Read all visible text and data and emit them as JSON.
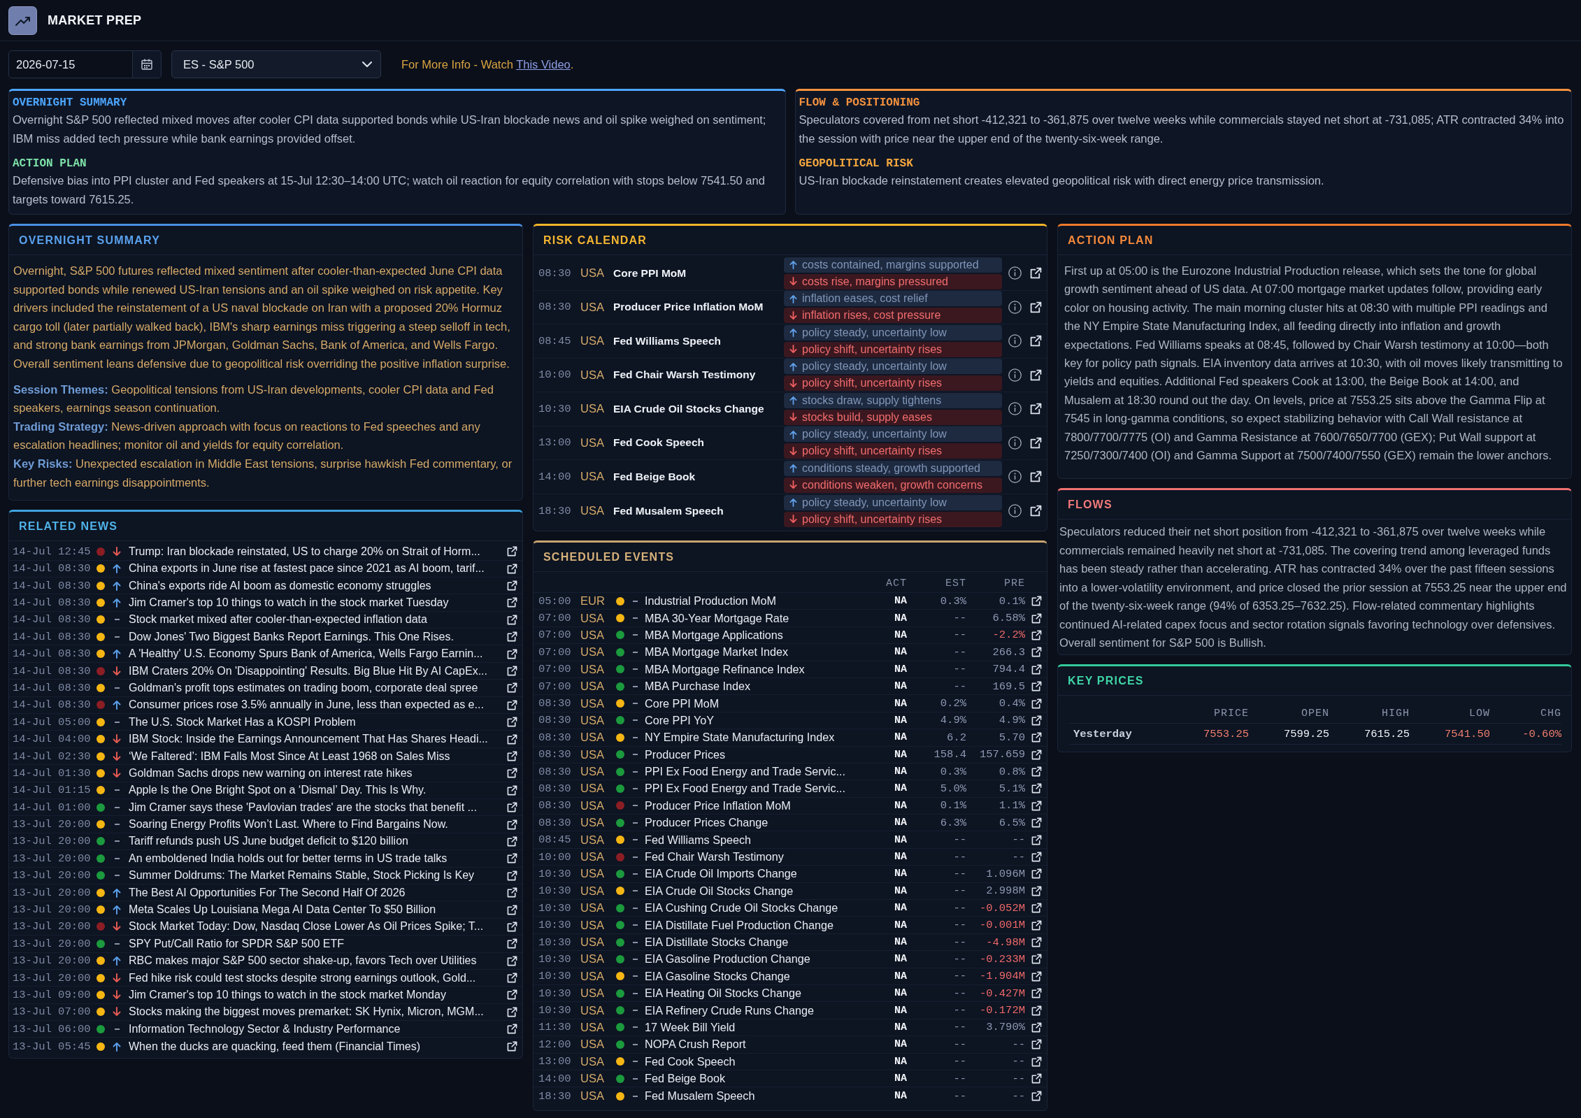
{
  "app": {
    "title": "MARKET PREP"
  },
  "controls": {
    "date": "2026-07-15",
    "instrument": "ES - S&P 500",
    "info": {
      "text": "For More Info - Watch",
      "link": "This Video",
      "end": "."
    }
  },
  "briefing": [
    {
      "sections": [
        {
          "heading": "OVERNIGHT SUMMARY",
          "color": "#4da6ff",
          "text": "Overnight S&P 500 reflected mixed moves after cooler CPI data supported bonds while US-Iran blockade news and oil spike weighed on sentiment; IBM miss added tech pressure while bank earnings provided offset."
        },
        {
          "heading": "ACTION PLAN",
          "color": "#7ee2a8",
          "text": "Defensive bias into PPI cluster and Fed speakers at 15-Jul 12:30–14:00 UTC; watch oil reaction for equity correlation with stops below 7541.50 and targets toward 7615.25."
        }
      ]
    },
    {
      "sections": [
        {
          "heading": "FLOW & POSITIONING",
          "color": "#f5923e",
          "text": "Speculators covered from net short -412,321 to -361,875 over twelve weeks while commercials stayed net short at -731,085; ATR contracted 34% into the session with price near the upper end of the twenty-six-week range."
        },
        {
          "heading": "GEOPOLITICAL RISK",
          "color": "#f7a83e",
          "text": "US-Iran blockade reinstatement creates elevated geopolitical risk with direct energy price transmission."
        }
      ]
    }
  ],
  "overnight": {
    "title": "OVERNIGHT SUMMARY",
    "text": "Overnight, S&P 500 futures reflected mixed sentiment after cooler-than-expected June CPI data supported bonds while renewed US-Iran tensions and an oil spike weighed on risk appetite. Key drivers included the reinstatement of a US naval blockade on Iran with a proposed 20% Hormuz cargo toll (later partially walked back), IBM's sharp earnings miss triggering a steep selloff in tech, and strong bank earnings from JPMorgan, Goldman Sachs, Bank of America, and Wells Fargo. Overall sentiment leans defensive due to geopolitical risk overriding the positive inflation surprise.",
    "details": [
      "**Session Themes:** Geopolitical tensions from US-Iran developments, cooler CPI data and Fed speakers, earnings season continuation.",
      "**Trading Strategy:** News-driven approach with focus on reactions to Fed speeches and any escalation headlines; monitor oil and yields for equity correlation.",
      "**Key Risks:** Unexpected escalation in Middle East tensions, surprise hawkish Fed commentary, or further tech earnings disappointments."
    ]
  },
  "news": {
    "title": "RELATED NEWS",
    "items": [
      {
        "time": "14-Jul 12:45",
        "color": "#8b1e24",
        "rising": false,
        "falling": true,
        "headline": "Trump: Iran blockade reinstated, US to charge 20% on Strait of Horm..."
      },
      {
        "time": "14-Jul 08:30",
        "color": "#f5b614",
        "rising": true,
        "falling": false,
        "headline": "China exports in June rise at fastest pace since 2021 as AI boom, tarif..."
      },
      {
        "time": "14-Jul 08:30",
        "color": "#f5b614",
        "rising": true,
        "falling": false,
        "headline": "China's exports ride AI boom as domestic economy struggles"
      },
      {
        "time": "14-Jul 08:30",
        "color": "#f5b614",
        "rising": true,
        "falling": false,
        "headline": "Jim Cramer's top 10 things to watch in the stock market Tuesday"
      },
      {
        "time": "14-Jul 08:30",
        "color": "#f5b614",
        "rising": false,
        "falling": false,
        "headline": "Stock market mixed after cooler-than-expected inflation data"
      },
      {
        "time": "14-Jul 08:30",
        "color": "#f5b614",
        "rising": false,
        "falling": false,
        "headline": "Dow Jones' Two Biggest Banks Report Earnings. This One Rises."
      },
      {
        "time": "14-Jul 08:30",
        "color": "#f5b614",
        "rising": true,
        "falling": false,
        "headline": "A 'Healthy' U.S. Economy Spurs Bank of America, Wells Fargo Earnin..."
      },
      {
        "time": "14-Jul 08:30",
        "color": "#8b1e24",
        "rising": false,
        "falling": true,
        "headline": "IBM Craters 20% On 'Disappointing' Results. Big Blue Hit By AI CapEx..."
      },
      {
        "time": "14-Jul 08:30",
        "color": "#f5b614",
        "rising": false,
        "falling": false,
        "headline": "Goldman's profit tops estimates on trading boom, corporate deal spree"
      },
      {
        "time": "14-Jul 08:30",
        "color": "#8b1e24",
        "rising": true,
        "falling": false,
        "headline": "Consumer prices rose 3.5% annually in June, less than expected as e..."
      },
      {
        "time": "14-Jul 05:00",
        "color": "#f5b614",
        "rising": false,
        "falling": false,
        "headline": "The U.S. Stock Market Has a KOSPI Problem"
      },
      {
        "time": "14-Jul 04:00",
        "color": "#f5b614",
        "rising": false,
        "falling": true,
        "headline": "IBM Stock: Inside the Earnings Announcement That Has Shares Headi..."
      },
      {
        "time": "14-Jul 02:30",
        "color": "#f5b614",
        "rising": false,
        "falling": true,
        "headline": "‘We Faltered’: IBM Falls Most Since At Least 1968 on Sales Miss"
      },
      {
        "time": "14-Jul 01:30",
        "color": "#f5b614",
        "rising": false,
        "falling": true,
        "headline": "Goldman Sachs drops new warning on interest rate hikes"
      },
      {
        "time": "14-Jul 01:15",
        "color": "#f5b614",
        "rising": false,
        "falling": false,
        "headline": "Apple Is the One Bright Spot on a ‘Dismal’ Day. This Is Why."
      },
      {
        "time": "14-Jul 01:00",
        "color": "#1c9a3e",
        "rising": false,
        "falling": false,
        "headline": "Jim Cramer says these 'Pavlovian trades' are the stocks that benefit ..."
      },
      {
        "time": "13-Jul 20:00",
        "color": "#f5b614",
        "rising": false,
        "falling": false,
        "headline": "Soaring Energy Profits Won’t Last. Where to Find Bargains Now."
      },
      {
        "time": "13-Jul 20:00",
        "color": "#1c9a3e",
        "rising": false,
        "falling": false,
        "headline": "Tariff refunds push US June budget deficit to $120 billion"
      },
      {
        "time": "13-Jul 20:00",
        "color": "#1c9a3e",
        "rising": false,
        "falling": false,
        "headline": "An emboldened India holds out for better terms in US trade talks"
      },
      {
        "time": "13-Jul 20:00",
        "color": "#1c9a3e",
        "rising": false,
        "falling": false,
        "headline": "Summer Doldrums: The Market Remains Stable, Stock Picking Is Key"
      },
      {
        "time": "13-Jul 20:00",
        "color": "#f5b614",
        "rising": true,
        "falling": false,
        "headline": "The Best AI Opportunities For The Second Half Of 2026"
      },
      {
        "time": "13-Jul 20:00",
        "color": "#f5b614",
        "rising": true,
        "falling": false,
        "headline": "Meta Scales Up Louisiana Mega AI Data Center To $50 Billion"
      },
      {
        "time": "13-Jul 20:00",
        "color": "#8b1e24",
        "rising": false,
        "falling": true,
        "headline": "Stock Market Today: Dow, Nasdaq Close Lower As Oil Prices Spike; T..."
      },
      {
        "time": "13-Jul 20:00",
        "color": "#1c9a3e",
        "rising": false,
        "falling": false,
        "headline": "SPY Put/Call Ratio for SPDR S&P 500 ETF"
      },
      {
        "time": "13-Jul 20:00",
        "color": "#f5b614",
        "rising": true,
        "falling": false,
        "headline": "RBC makes major S&P 500 sector shake-up, favors Tech over Utilities"
      },
      {
        "time": "13-Jul 20:00",
        "color": "#f5b614",
        "rising": false,
        "falling": true,
        "headline": "Fed hike risk could test stocks despite strong earnings outlook, Gold..."
      },
      {
        "time": "13-Jul 09:00",
        "color": "#f5b614",
        "rising": false,
        "falling": true,
        "headline": "Jim Cramer's top 10 things to watch in the stock market Monday"
      },
      {
        "time": "13-Jul 07:00",
        "color": "#f5b614",
        "rising": false,
        "falling": true,
        "headline": "Stocks making the biggest moves premarket: SK Hynix, Micron, MGM..."
      },
      {
        "time": "13-Jul 06:00",
        "color": "#1c9a3e",
        "rising": false,
        "falling": false,
        "headline": "Information Technology Sector & Industry Performance"
      },
      {
        "time": "13-Jul 05:45",
        "color": "#f5b614",
        "rising": true,
        "falling": false,
        "headline": "When the ducks are quacking, feed them (Financial Times)"
      }
    ]
  },
  "risk_calendar": {
    "title": "RISK CALENDAR",
    "rows": [
      {
        "time": "08:30",
        "region": "USA",
        "event": "Core PPI MoM",
        "upside": "costs contained, margins supported",
        "downside": "costs rise, margins pressured"
      },
      {
        "time": "08:30",
        "region": "USA",
        "event": "Producer Price Inflation MoM",
        "upside": "inflation eases, cost relief",
        "downside": "inflation rises, cost pressure"
      },
      {
        "time": "08:45",
        "region": "USA",
        "event": "Fed Williams Speech",
        "upside": "policy steady, uncertainty low",
        "downside": "policy shift, uncertainty rises"
      },
      {
        "time": "10:00",
        "region": "USA",
        "event": "Fed Chair Warsh Testimony",
        "upside": "policy steady, uncertainty low",
        "downside": "policy shift, uncertainty rises"
      },
      {
        "time": "10:30",
        "region": "USA",
        "event": "EIA Crude Oil Stocks Change",
        "upside": "stocks draw, supply tightens",
        "downside": "stocks build, supply eases"
      },
      {
        "time": "13:00",
        "region": "USA",
        "event": "Fed Cook Speech",
        "upside": "policy steady, uncertainty low",
        "downside": "policy shift, uncertainty rises"
      },
      {
        "time": "14:00",
        "region": "USA",
        "event": "Fed Beige Book",
        "upside": "conditions steady, growth supported",
        "downside": "conditions weaken, growth concerns"
      },
      {
        "time": "18:30",
        "region": "USA",
        "event": "Fed Musalem Speech",
        "upside": "policy steady, uncertainty low",
        "downside": "policy shift, uncertainty rises"
      }
    ]
  },
  "events": {
    "title": "SCHEDULED EVENTS",
    "columns": [
      "ACT",
      "EST",
      "PRE"
    ],
    "rows": [
      {
        "time": "05:00",
        "region": "EUR",
        "color": "#f5b614",
        "rising": false,
        "falling": false,
        "name": "Industrial Production MoM",
        "act": "NA",
        "est": "0.3%",
        "pre": "0.1%",
        "pre_negative": false
      },
      {
        "time": "07:00",
        "region": "USA",
        "color": "#f5b614",
        "rising": false,
        "falling": false,
        "name": "MBA 30-Year Mortgage Rate",
        "act": "NA",
        "est": "--",
        "pre": "6.58%",
        "pre_negative": false
      },
      {
        "time": "07:00",
        "region": "USA",
        "color": "#1c9a3e",
        "rising": false,
        "falling": false,
        "name": "MBA Mortgage Applications",
        "act": "NA",
        "est": "--",
        "pre": "-2.2%",
        "pre_negative": true
      },
      {
        "time": "07:00",
        "region": "USA",
        "color": "#1c9a3e",
        "rising": false,
        "falling": false,
        "name": "MBA Mortgage Market Index",
        "act": "NA",
        "est": "--",
        "pre": "266.3",
        "pre_negative": false
      },
      {
        "time": "07:00",
        "region": "USA",
        "color": "#1c9a3e",
        "rising": false,
        "falling": false,
        "name": "MBA Mortgage Refinance Index",
        "act": "NA",
        "est": "--",
        "pre": "794.4",
        "pre_negative": false
      },
      {
        "time": "07:00",
        "region": "USA",
        "color": "#1c9a3e",
        "rising": false,
        "falling": false,
        "name": "MBA Purchase Index",
        "act": "NA",
        "est": "--",
        "pre": "169.5",
        "pre_negative": false
      },
      {
        "time": "08:30",
        "region": "USA",
        "color": "#f5b614",
        "rising": false,
        "falling": false,
        "name": "Core PPI MoM",
        "act": "NA",
        "est": "0.2%",
        "pre": "0.4%",
        "pre_negative": false
      },
      {
        "time": "08:30",
        "region": "USA",
        "color": "#1c9a3e",
        "rising": false,
        "falling": false,
        "name": "Core PPI YoY",
        "act": "NA",
        "est": "4.9%",
        "pre": "4.9%",
        "pre_negative": false
      },
      {
        "time": "08:30",
        "region": "USA",
        "color": "#f5b614",
        "rising": false,
        "falling": false,
        "name": "NY Empire State Manufacturing Index",
        "act": "NA",
        "est": "6.2",
        "pre": "5.70",
        "pre_negative": false
      },
      {
        "time": "08:30",
        "region": "USA",
        "color": "#1c9a3e",
        "rising": false,
        "falling": false,
        "name": "Producer Prices",
        "act": "NA",
        "est": "158.4",
        "pre": "157.659",
        "pre_negative": false
      },
      {
        "time": "08:30",
        "region": "USA",
        "color": "#1c9a3e",
        "rising": false,
        "falling": false,
        "name": "PPI Ex Food Energy and Trade Servic...",
        "act": "NA",
        "est": "0.3%",
        "pre": "0.8%",
        "pre_negative": false
      },
      {
        "time": "08:30",
        "region": "USA",
        "color": "#1c9a3e",
        "rising": false,
        "falling": false,
        "name": "PPI Ex Food Energy and Trade Servic...",
        "act": "NA",
        "est": "5.0%",
        "pre": "5.1%",
        "pre_negative": false
      },
      {
        "time": "08:30",
        "region": "USA",
        "color": "#8b1e24",
        "rising": false,
        "falling": false,
        "name": "Producer Price Inflation MoM",
        "act": "NA",
        "est": "0.1%",
        "pre": "1.1%",
        "pre_negative": false
      },
      {
        "time": "08:30",
        "region": "USA",
        "color": "#1c9a3e",
        "rising": false,
        "falling": false,
        "name": "Producer Prices Change",
        "act": "NA",
        "est": "6.3%",
        "pre": "6.5%",
        "pre_negative": false
      },
      {
        "time": "08:45",
        "region": "USA",
        "color": "#f5b614",
        "rising": false,
        "falling": false,
        "name": "Fed Williams Speech",
        "act": "NA",
        "est": "--",
        "pre": "--",
        "pre_negative": false
      },
      {
        "time": "10:00",
        "region": "USA",
        "color": "#8b1e24",
        "rising": false,
        "falling": false,
        "name": "Fed Chair Warsh Testimony",
        "act": "NA",
        "est": "--",
        "pre": "--",
        "pre_negative": false
      },
      {
        "time": "10:30",
        "region": "USA",
        "color": "#1c9a3e",
        "rising": false,
        "falling": false,
        "name": "EIA Crude Oil Imports Change",
        "act": "NA",
        "est": "--",
        "pre": "1.096M",
        "pre_negative": false
      },
      {
        "time": "10:30",
        "region": "USA",
        "color": "#f5b614",
        "rising": false,
        "falling": false,
        "name": "EIA Crude Oil Stocks Change",
        "act": "NA",
        "est": "--",
        "pre": "2.998M",
        "pre_negative": false
      },
      {
        "time": "10:30",
        "region": "USA",
        "color": "#1c9a3e",
        "rising": false,
        "falling": false,
        "name": "EIA Cushing Crude Oil Stocks Change",
        "act": "NA",
        "est": "--",
        "pre": "-0.052M",
        "pre_negative": true
      },
      {
        "time": "10:30",
        "region": "USA",
        "color": "#1c9a3e",
        "rising": false,
        "falling": false,
        "name": "EIA Distillate Fuel Production Change",
        "act": "NA",
        "est": "--",
        "pre": "-0.001M",
        "pre_negative": true
      },
      {
        "time": "10:30",
        "region": "USA",
        "color": "#1c9a3e",
        "rising": false,
        "falling": false,
        "name": "EIA Distillate Stocks Change",
        "act": "NA",
        "est": "--",
        "pre": "-4.98M",
        "pre_negative": true
      },
      {
        "time": "10:30",
        "region": "USA",
        "color": "#1c9a3e",
        "rising": false,
        "falling": false,
        "name": "EIA Gasoline Production Change",
        "act": "NA",
        "est": "--",
        "pre": "-0.233M",
        "pre_negative": true
      },
      {
        "time": "10:30",
        "region": "USA",
        "color": "#f5b614",
        "rising": false,
        "falling": false,
        "name": "EIA Gasoline Stocks Change",
        "act": "NA",
        "est": "--",
        "pre": "-1.904M",
        "pre_negative": true
      },
      {
        "time": "10:30",
        "region": "USA",
        "color": "#1c9a3e",
        "rising": false,
        "falling": false,
        "name": "EIA Heating Oil Stocks Change",
        "act": "NA",
        "est": "--",
        "pre": "-0.427M",
        "pre_negative": true
      },
      {
        "time": "10:30",
        "region": "USA",
        "color": "#1c9a3e",
        "rising": false,
        "falling": false,
        "name": "EIA Refinery Crude Runs Change",
        "act": "NA",
        "est": "--",
        "pre": "-0.172M",
        "pre_negative": true
      },
      {
        "time": "11:30",
        "region": "USA",
        "color": "#1c9a3e",
        "rising": false,
        "falling": false,
        "name": "17 Week Bill Yield",
        "act": "NA",
        "est": "--",
        "pre": "3.790%",
        "pre_negative": false
      },
      {
        "time": "12:00",
        "region": "USA",
        "color": "#1c9a3e",
        "rising": false,
        "falling": false,
        "name": "NOPA Crush Report",
        "act": "NA",
        "est": "--",
        "pre": "--",
        "pre_negative": false
      },
      {
        "time": "13:00",
        "region": "USA",
        "color": "#f5b614",
        "rising": false,
        "falling": false,
        "name": "Fed Cook Speech",
        "act": "NA",
        "est": "--",
        "pre": "--",
        "pre_negative": false
      },
      {
        "time": "14:00",
        "region": "USA",
        "color": "#1c9a3e",
        "rising": false,
        "falling": false,
        "name": "Fed Beige Book",
        "act": "NA",
        "est": "--",
        "pre": "--",
        "pre_negative": false
      },
      {
        "time": "18:30",
        "region": "USA",
        "color": "#f5b614",
        "rising": false,
        "falling": false,
        "name": "Fed Musalem Speech",
        "act": "NA",
        "est": "--",
        "pre": "--",
        "pre_negative": false
      }
    ]
  },
  "action_plan": {
    "title": "ACTION PLAN",
    "text": "First up at 05:00 is the Eurozone Industrial Production release, which sets the tone for global growth sentiment ahead of US data. At 07:00 mortgage market updates follow, providing early color on housing activity. The main morning cluster hits at 08:30 with multiple PPI readings and the NY Empire State Manufacturing Index, all feeding directly into inflation and growth expectations. Fed Williams speaks at 08:45, followed by Chair Warsh testimony at 10:00—both key for policy path signals. EIA inventory data arrives at 10:30, with oil moves likely transmitting to yields and equities. Additional Fed speakers Cook at 13:00, the Beige Book at 14:00, and Musalem at 18:30 round out the day. On levels, price at 7553.25 sits above the Gamma Flip at 7545 in long-gamma conditions, so expect stabilizing behavior with Call Wall resistance at 7800/7700/7775 (OI) and Gamma Resistance at 7600/7650/7700 (GEX); Put Wall support at 7250/7300/7400 (OI) and Gamma Support at 7500/7400/7550 (GEX) remain the lower anchors."
  },
  "flows": {
    "title": "FLOWS",
    "text": "Speculators reduced their net short position from -412,321 to -361,875 over twelve weeks while commercials remained heavily net short at -731,085. The covering trend among leveraged funds has been steady rather than accelerating. ATR has contracted 34% over the past fifteen sessions into a lower-volatility environment, and price closed the prior session at 7553.25 near the upper end of the twenty-six-week range (94% of 6353.25–7632.25). Flow-related commentary highlights continued AI-related capex focus and sector rotation signals favoring technology over defensives. Overall sentiment for S&P 500 is Bullish."
  },
  "key_prices": {
    "title": "KEY PRICES",
    "columns": [
      "PRICE",
      "OPEN",
      "HIGH",
      "LOW",
      "CHG"
    ],
    "rows": [
      {
        "label": "Yesterday",
        "cells": [
          {
            "value": "7553.25",
            "down": true
          },
          {
            "value": "7599.25",
            "down": false
          },
          {
            "value": "7615.25",
            "down": false
          },
          {
            "value": "7541.50",
            "down": true
          },
          {
            "value": "-0.60%",
            "down": true
          }
        ]
      }
    ]
  }
}
